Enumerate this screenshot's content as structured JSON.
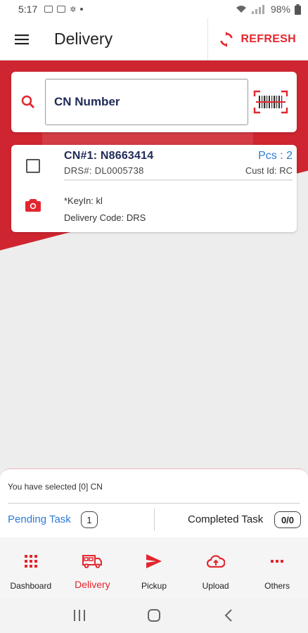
{
  "status_bar": {
    "time": "5:17",
    "battery": "98%"
  },
  "app_bar": {
    "title": "Delivery",
    "refresh_label": "REFRESH"
  },
  "search": {
    "placeholder": "CN Number"
  },
  "cn_card": {
    "cn_no": "CN#1: N8663414",
    "pcs": "Pcs : 2",
    "drs": "DRS#: DL0005738",
    "cust_id": "Cust Id: RC",
    "keyin": "*KeyIn: kl",
    "delivery_code": "Delivery Code: DRS"
  },
  "selection": {
    "text": "You have selected [0] CN",
    "pending_label": "Pending Task",
    "pending_count": "1",
    "completed_label": "Completed Task",
    "completed_count": "0/0"
  },
  "bottom_nav": {
    "items": [
      {
        "label": "Dashboard",
        "icon": "grid-icon"
      },
      {
        "label": "Delivery",
        "icon": "truck-icon",
        "active": true
      },
      {
        "label": "Pickup",
        "icon": "send-icon"
      },
      {
        "label": "Upload",
        "icon": "cloud-upload-icon"
      },
      {
        "label": "Others",
        "icon": "more-icon"
      }
    ]
  },
  "colors": {
    "accent": "#e3262e",
    "band": "#cf2530",
    "navy": "#1f2b55",
    "link": "#2b7bd6"
  }
}
